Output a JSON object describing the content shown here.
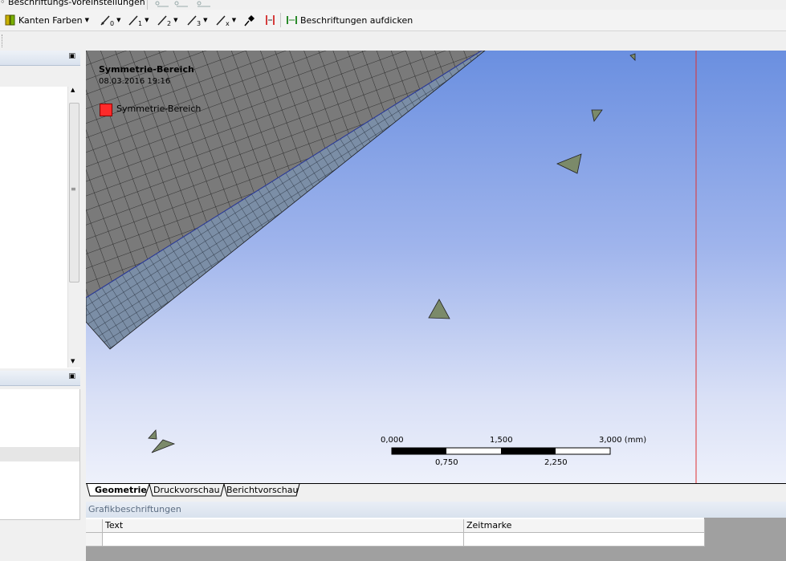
{
  "top_toolbar": {
    "label_presets": "Beschriftungs-Voreinstellungen"
  },
  "edge_toolbar": {
    "edge_colors_label": "Kanten Farben",
    "thicken_annotations_label": "Beschriftungen aufdicken",
    "edge_tool_subscripts": [
      "0",
      "1",
      "2",
      "3",
      "x"
    ],
    "icons": [
      "edge-color-icon",
      "no-wireframe-icon",
      "edge-1-icon",
      "edge-2-icon",
      "edge-3-icon",
      "edge-x-icon",
      "pin-icon",
      "thicken-icon"
    ]
  },
  "viewport": {
    "legend": {
      "title": "Symmetrie-Bereich",
      "date": "08.03.2016 19:16",
      "item_label": "Symmetrie-Bereich",
      "item_color": "#ff2a2a"
    },
    "scale_bar": {
      "top_labels": [
        "0,000",
        "1,500",
        "3,000 (mm)"
      ],
      "bottom_labels": [
        "0,750",
        "2,250"
      ]
    },
    "background_top": "#6a8fe0",
    "background_bottom": "#eef1fb",
    "mesh_fill": "#7a7a7a",
    "boundary_layer_fill": "#7b8ea6",
    "triad_fill": "#7b8a6a"
  },
  "view_tabs": [
    {
      "label": "Geometrie",
      "active": true
    },
    {
      "label": "Druckvorschau",
      "active": false
    },
    {
      "label": "Berichtvorschau",
      "active": false
    }
  ],
  "annotations_panel": {
    "title": "Grafikbeschriftungen",
    "columns": [
      "Text",
      "Zeitmarke"
    ]
  }
}
